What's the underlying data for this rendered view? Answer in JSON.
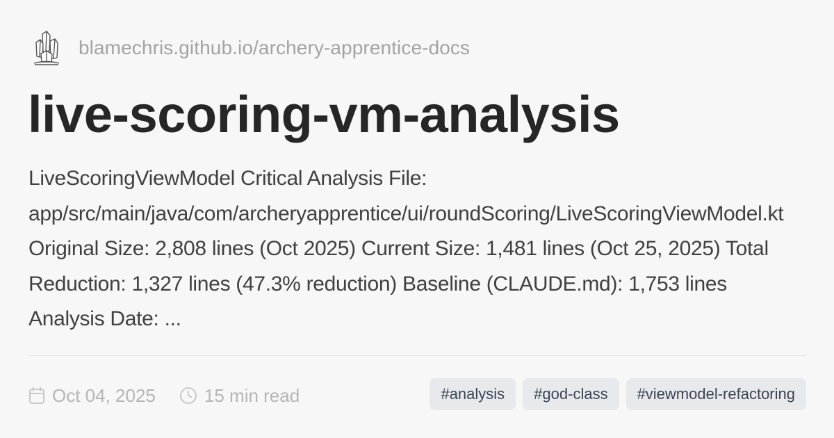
{
  "site": {
    "logo_icon": "crystal-icon",
    "url": "blamechris.github.io/archery-apprentice-docs"
  },
  "post": {
    "title": "live-scoring-vm-analysis",
    "excerpt": "LiveScoringViewModel Critical Analysis File: app/src/main/java/com/archeryapprentice/ui/roundScoring/LiveScoringViewModel.kt Original Size: 2,808 lines (Oct 2025) Current Size: 1,481 lines (Oct 25, 2025) Total Reduction: 1,327 lines (47.3% reduction) Baseline (CLAUDE.md): 1,753 lines Analysis Date: ...",
    "date": "Oct 04, 2025",
    "date_icon": "calendar-icon",
    "read_time": "15 min read",
    "read_time_icon": "clock-icon",
    "tags": [
      "#analysis",
      "#god-class",
      "#viewmodel-refactoring"
    ]
  },
  "colors": {
    "background": "#f7f7f8",
    "title": "#262626",
    "url": "#a3a3a3",
    "tag_background": "#e7e9ec",
    "tag_text": "#3a4452"
  }
}
